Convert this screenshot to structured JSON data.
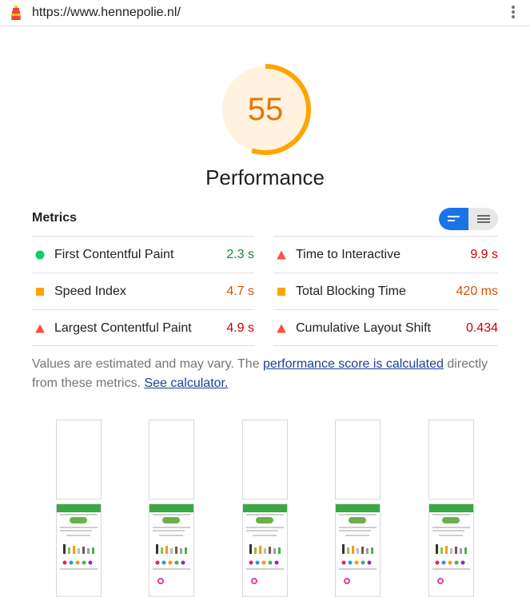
{
  "topbar": {
    "url": "https://www.hennepolie.nl/",
    "logo_icon": "lighthouse-icon",
    "menu_icon": "more-vert-icon"
  },
  "gauge": {
    "score": "55",
    "fraction": 0.55,
    "color": "#ffa400",
    "bg": "#fff3e0"
  },
  "title": "Performance",
  "metrics": {
    "header": "Metrics",
    "left": [
      {
        "label": "First Contentful Paint",
        "value": "2.3 s",
        "status": "good"
      },
      {
        "label": "Speed Index",
        "value": "4.7 s",
        "status": "avg"
      },
      {
        "label": "Largest Contentful Paint",
        "value": "4.9 s",
        "status": "bad"
      }
    ],
    "right": [
      {
        "label": "Time to Interactive",
        "value": "9.9 s",
        "status": "bad"
      },
      {
        "label": "Total Blocking Time",
        "value": "420 ms",
        "status": "avg"
      },
      {
        "label": "Cumulative Layout Shift",
        "value": "0.434",
        "status": "bad"
      }
    ]
  },
  "note": {
    "prefix": "Values are estimated and may vary. The ",
    "link1": "performance score is calculated",
    "middle": " directly from these metrics. ",
    "link2": "See calculator."
  },
  "colors": {
    "good": "#0cce6b",
    "avg": "#ffa400",
    "bad": "#ff4e42",
    "toggle_active": "#1a73e8"
  },
  "filmstrip": {
    "frames": 5
  }
}
